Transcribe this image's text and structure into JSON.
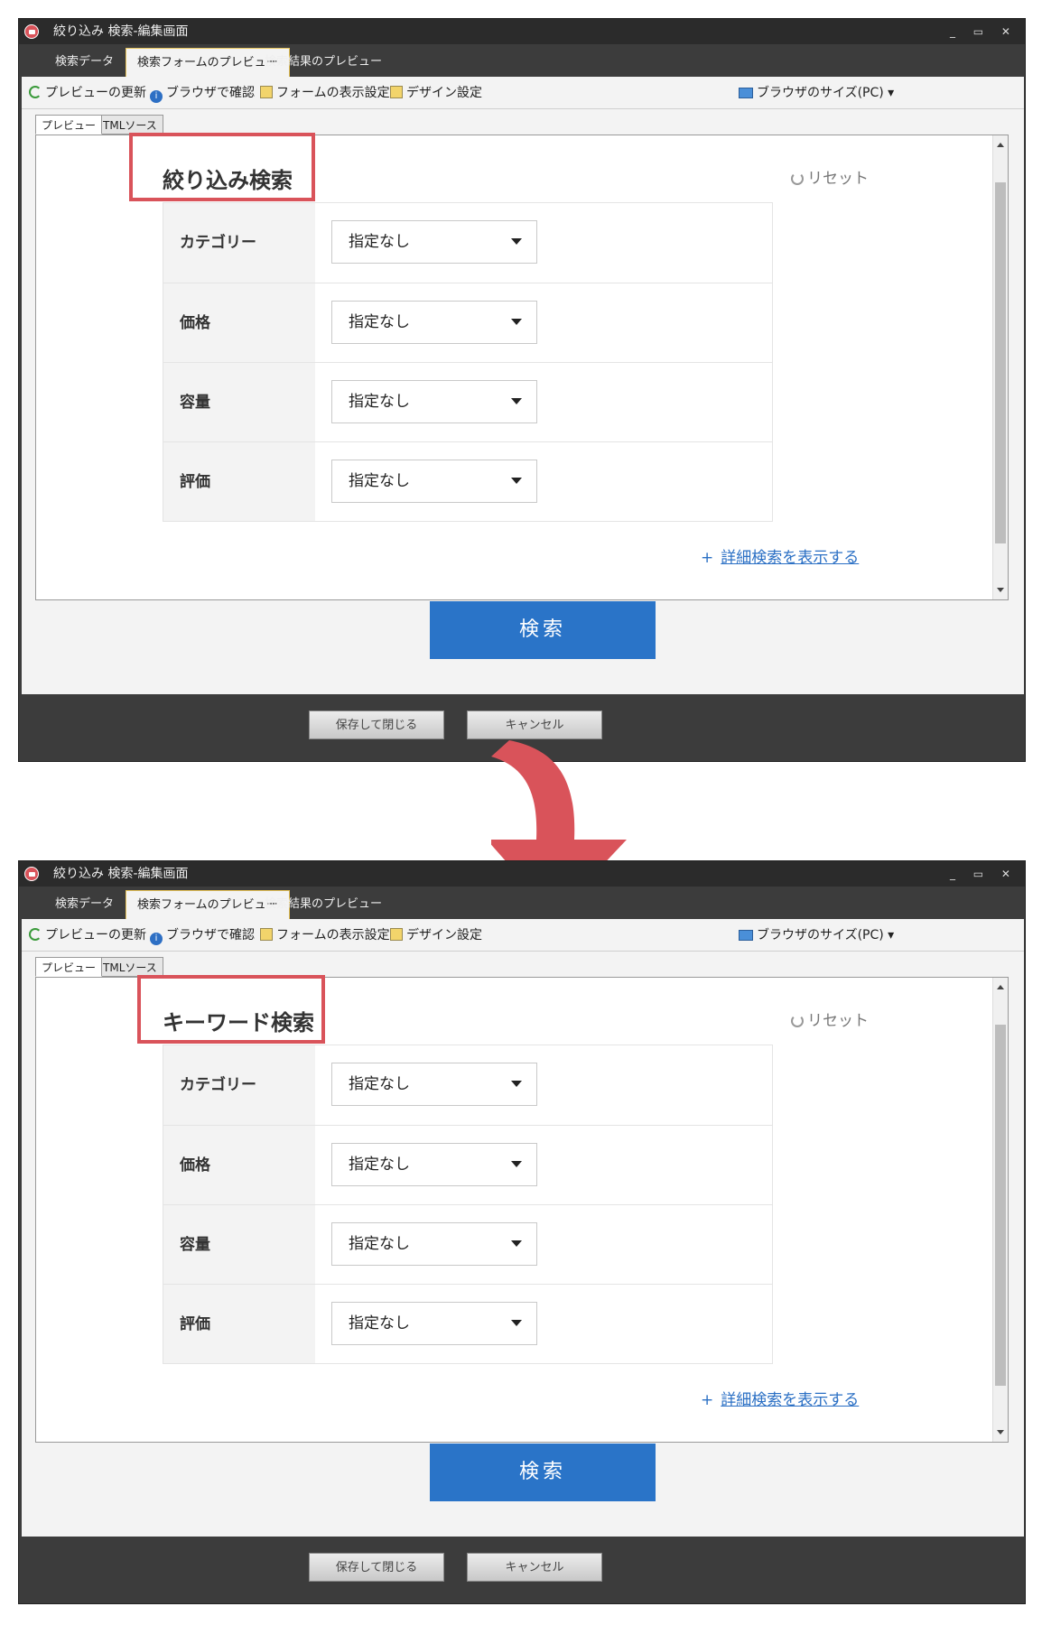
{
  "screenshots": [
    {
      "window_title": "絞り込み 検索-編集画面",
      "window_controls": "_ ▭ ✕",
      "tabs": [
        {
          "label": "検索データ"
        },
        {
          "label": "検索フォームのプレビュー"
        },
        {
          "label": "検索結果のプレビュー"
        }
      ],
      "toolbar": {
        "refresh": "プレビューの更新",
        "browser_check": "ブラウザで確認",
        "form_display": "フォームの表示設定",
        "design": "デザイン設定",
        "browser_size": "ブラウザのサイズ(PC)"
      },
      "subtabs": {
        "preview": "プレビュー",
        "html": "HTMLソース"
      },
      "form": {
        "title": "絞り込み検索",
        "reset": "リセット",
        "rows": [
          {
            "label": "カテゴリー",
            "value": "指定なし"
          },
          {
            "label": "価格",
            "value": "指定なし"
          },
          {
            "label": "容量",
            "value": "指定なし"
          },
          {
            "label": "評価",
            "value": "指定なし"
          }
        ],
        "advanced_plus": "+",
        "advanced": "詳細検索を表示する",
        "search": "検索"
      },
      "footer": {
        "save": "保存して閉じる",
        "cancel": "キャンセル"
      }
    },
    {
      "window_title": "絞り込み 検索-編集画面",
      "window_controls": "_ ▭ ✕",
      "tabs": [
        {
          "label": "検索データ"
        },
        {
          "label": "検索フォームのプレビュー"
        },
        {
          "label": "検索結果のプレビュー"
        }
      ],
      "toolbar": {
        "refresh": "プレビューの更新",
        "browser_check": "ブラウザで確認",
        "form_display": "フォームの表示設定",
        "design": "デザイン設定",
        "browser_size": "ブラウザのサイズ(PC)"
      },
      "subtabs": {
        "preview": "プレビュー",
        "html": "HTMLソース"
      },
      "form": {
        "title": "キーワード検索",
        "reset": "リセット",
        "rows": [
          {
            "label": "カテゴリー",
            "value": "指定なし"
          },
          {
            "label": "価格",
            "value": "指定なし"
          },
          {
            "label": "容量",
            "value": "指定なし"
          },
          {
            "label": "評価",
            "value": "指定なし"
          }
        ],
        "advanced_plus": "+",
        "advanced": "詳細検索を表示する",
        "search": "検索"
      },
      "footer": {
        "save": "保存して閉じる",
        "cancel": "キャンセル"
      }
    }
  ],
  "colors": {
    "highlight": "#d9535a",
    "arrow": "#d9535a",
    "primary_button": "#2a74c8",
    "link": "#2a6fc4",
    "window_chrome": "#3c3c3c"
  }
}
